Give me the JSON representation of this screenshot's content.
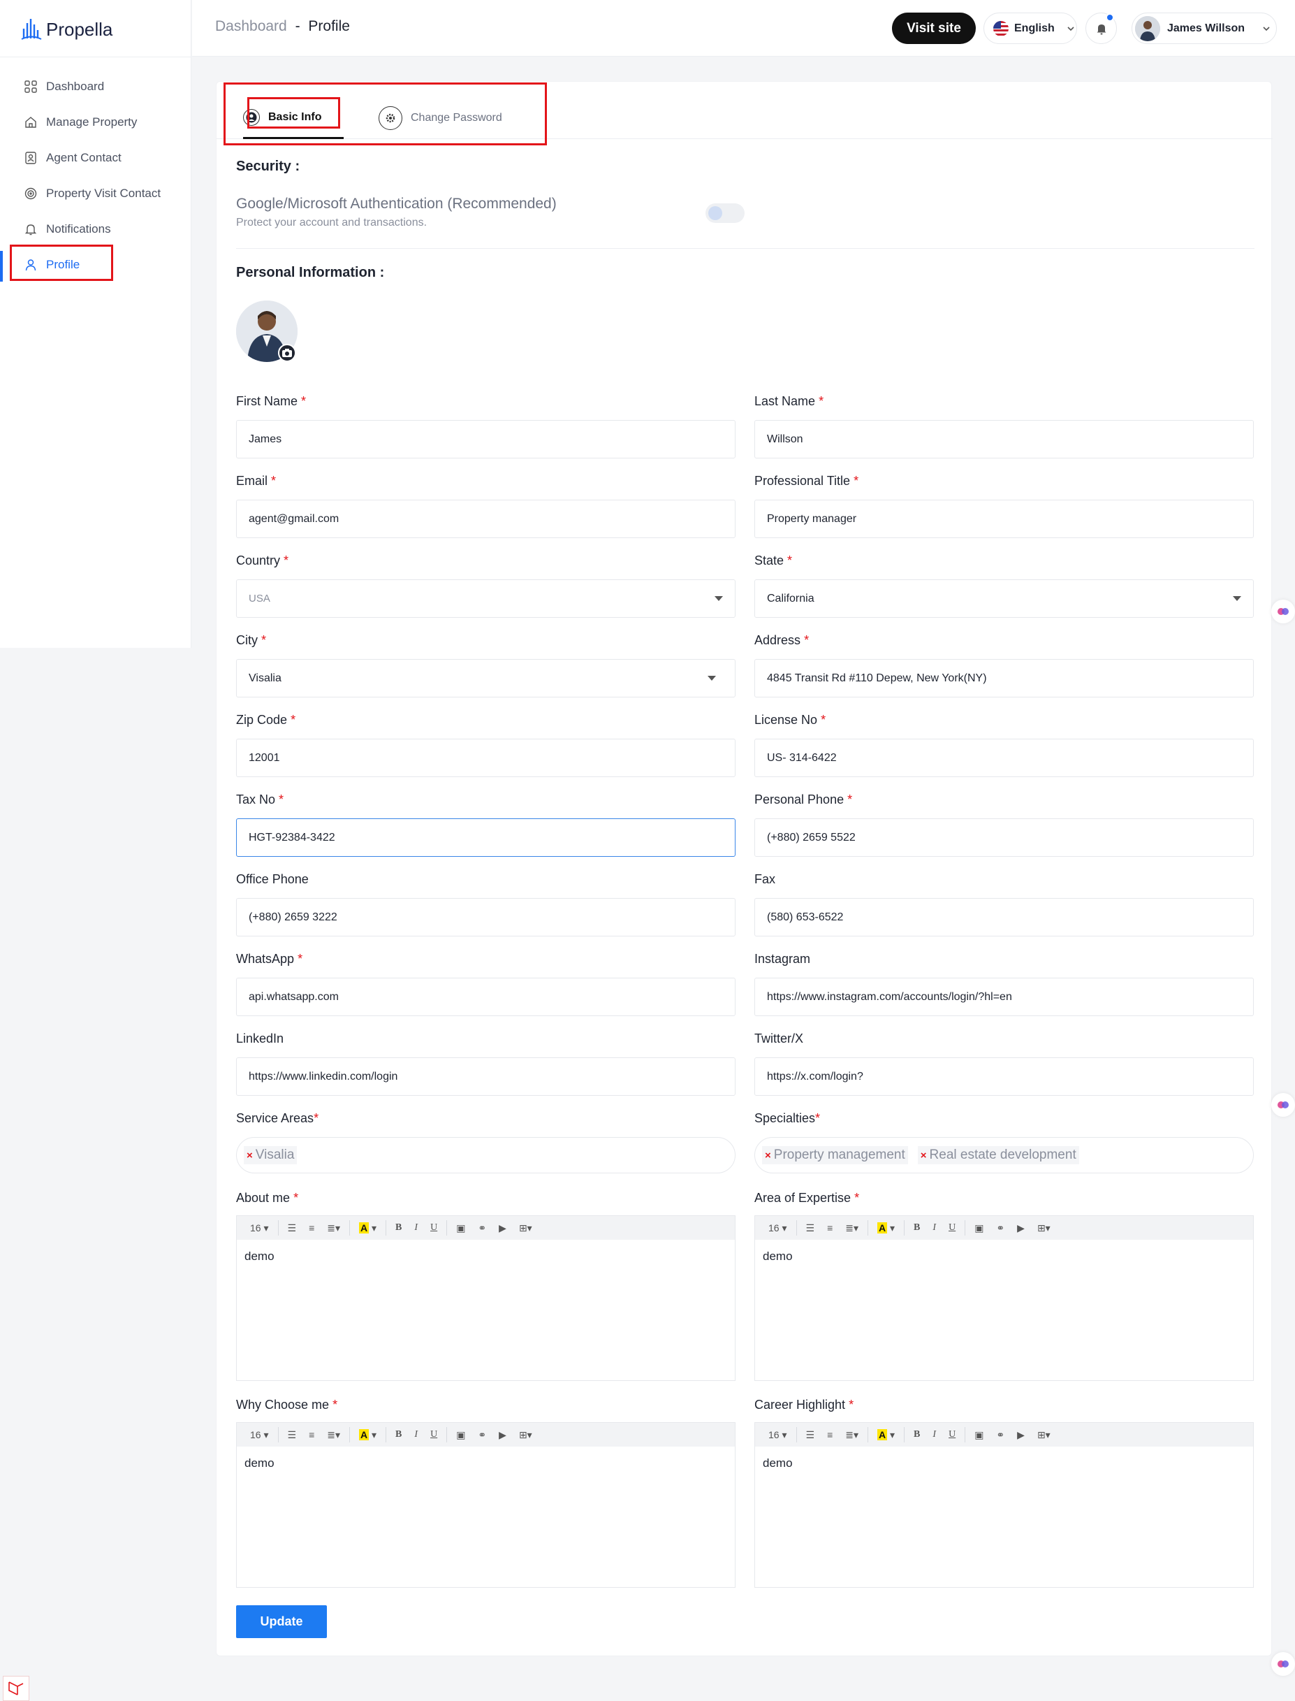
{
  "app": {
    "name": "Propella"
  },
  "sidebar": {
    "items": [
      {
        "label": "Dashboard",
        "icon": "grid-icon"
      },
      {
        "label": "Manage Property",
        "icon": "home-icon"
      },
      {
        "label": "Agent Contact",
        "icon": "contact-icon"
      },
      {
        "label": "Property Visit Contact",
        "icon": "target-icon"
      },
      {
        "label": "Notifications",
        "icon": "bell-icon"
      },
      {
        "label": "Profile",
        "icon": "user-icon",
        "active": true
      }
    ]
  },
  "header": {
    "breadcrumb_root": "Dashboard",
    "breadcrumb_sep": "-",
    "breadcrumb_current": "Profile",
    "visit_site": "Visit site",
    "language": "English",
    "user_name": "James Willson"
  },
  "tabs": [
    {
      "label": "Basic Info",
      "active": true
    },
    {
      "label": "Change Password",
      "active": false
    }
  ],
  "security": {
    "title": "Security :",
    "auth_title": "Google/Microsoft Authentication (Recommended)",
    "auth_subtitle": "Protect your account and transactions.",
    "enabled": false
  },
  "personal": {
    "title": "Personal Information :"
  },
  "fields": {
    "first_name": {
      "label": "First Name",
      "value": "James"
    },
    "last_name": {
      "label": "Last Name",
      "value": "Willson"
    },
    "email": {
      "label": "Email",
      "value": "agent@gmail.com"
    },
    "professional_title": {
      "label": "Professional Title",
      "value": "Property manager"
    },
    "country": {
      "label": "Country",
      "value": "USA"
    },
    "state": {
      "label": "State",
      "value": "California"
    },
    "city": {
      "label": "City",
      "value": "Visalia"
    },
    "address": {
      "label": "Address",
      "value": "4845 Transit Rd #110 Depew, New York(NY)"
    },
    "zip": {
      "label": "Zip Code",
      "value": "12001"
    },
    "license": {
      "label": "License No",
      "value": "US- 314-6422"
    },
    "tax": {
      "label": "Tax No",
      "value": "HGT-92384-3422"
    },
    "personal_phone": {
      "label": "Personal Phone",
      "value": "(+880) 2659 5522"
    },
    "office_phone": {
      "label": "Office Phone",
      "value": "(+880) 2659 3222"
    },
    "fax": {
      "label": "Fax",
      "value": "(580) 653-6522"
    },
    "whatsapp": {
      "label": "WhatsApp",
      "value": "api.whatsapp.com"
    },
    "instagram": {
      "label": "Instagram",
      "value": "https://www.instagram.com/accounts/login/?hl=en"
    },
    "linkedin": {
      "label": "LinkedIn",
      "value": "https://www.linkedin.com/login"
    },
    "twitter": {
      "label": "Twitter/X",
      "value": "https://x.com/login?"
    },
    "service_areas": {
      "label": "Service Areas",
      "tags": [
        "Visalia"
      ]
    },
    "specialties": {
      "label": "Specialties",
      "tags": [
        "Property management",
        "Real estate development"
      ]
    }
  },
  "editors": {
    "font_size": "16",
    "about": {
      "label": "About me",
      "content": "demo"
    },
    "expertise": {
      "label": "Area of Expertise",
      "content": "demo"
    },
    "why": {
      "label": "Why Choose me",
      "content": "demo"
    },
    "career": {
      "label": "Career Highlight",
      "content": "demo"
    }
  },
  "actions": {
    "update": "Update"
  },
  "colors": {
    "accent": "#1d6cf2",
    "highlight_box": "#e3151a",
    "required": "#e3151a"
  }
}
